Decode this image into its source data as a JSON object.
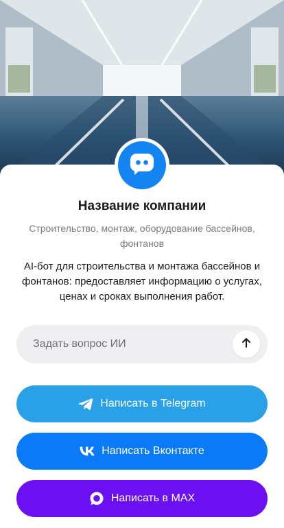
{
  "company": {
    "name": "Название компании",
    "subtitle": "Строительство, монтаж, оборудование бассейнов, фонтанов",
    "description": "AI-бот для строительства и монтажа бассейнов и фонтанов: предоставляет информацию о услугах, ценах и сроках выполнения работ."
  },
  "ask": {
    "placeholder": "Задать вопрос ИИ"
  },
  "buttons": {
    "telegram": "Написать в Telegram",
    "vk": "Написать Вконтакте",
    "max": "Написать в MAX"
  },
  "colors": {
    "avatar": "#1484f0",
    "telegram": "#2aa0e6",
    "vk": "#0a7af7",
    "max": "#6a10f2"
  },
  "icons": {
    "avatar": "chat-bot-icon",
    "send": "arrow-up-icon",
    "telegram": "telegram-icon",
    "vk": "vk-icon",
    "max": "max-icon"
  }
}
